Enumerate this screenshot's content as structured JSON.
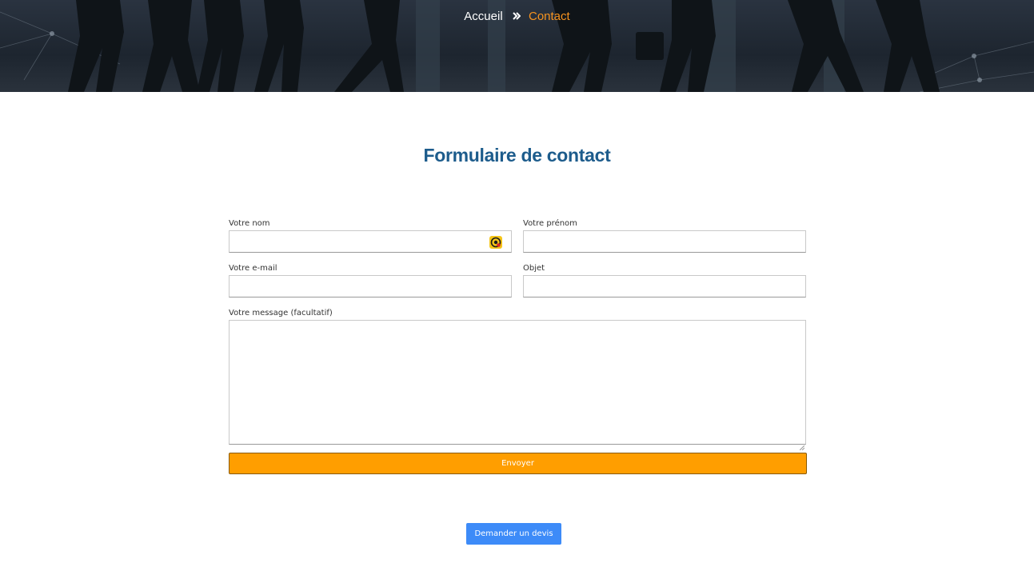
{
  "breadcrumb": {
    "home": "Accueil",
    "separator_icon": "double-chevron-right-icon",
    "current": "Contact"
  },
  "title": "Formulaire de contact",
  "form": {
    "nom": {
      "label": "Votre nom",
      "value": "",
      "autofill_icon": "autofill-extension-icon"
    },
    "prenom": {
      "label": "Votre prénom",
      "value": ""
    },
    "email": {
      "label": "Votre e-mail",
      "value": ""
    },
    "objet": {
      "label": "Objet",
      "value": ""
    },
    "message": {
      "label": "Votre message (facultatif)",
      "value": ""
    },
    "submit_label": "Envoyer"
  },
  "quote_button_label": "Demander un devis",
  "colors": {
    "title": "#1d5c8c",
    "breadcrumb_current": "#f7931e",
    "submit_bg": "#ff9e00",
    "quote_bg": "#3d8bf8",
    "hero_bg": "#1f2730"
  }
}
